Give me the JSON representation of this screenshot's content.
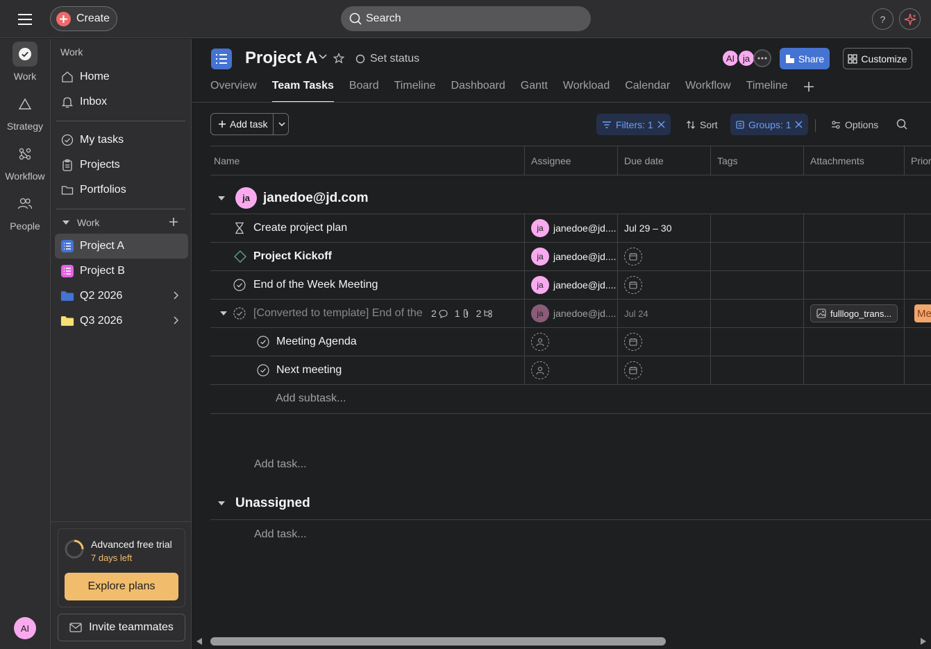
{
  "topbar": {
    "create_label": "Create",
    "search_placeholder": "Search",
    "help_label": "?"
  },
  "rail": {
    "items": [
      {
        "label": "Work",
        "icon": "check-circle-icon"
      },
      {
        "label": "Strategy",
        "icon": "triangle-icon"
      },
      {
        "label": "Workflow",
        "icon": "workflow-icon"
      },
      {
        "label": "People",
        "icon": "people-icon"
      }
    ],
    "avatar": "AI"
  },
  "sidebar": {
    "section_title": "Work",
    "nav": [
      {
        "label": "Home",
        "icon": "home-icon"
      },
      {
        "label": "Inbox",
        "icon": "bell-icon"
      }
    ],
    "nav2": [
      {
        "label": "My tasks",
        "icon": "check-circle-icon"
      },
      {
        "label": "Projects",
        "icon": "clipboard-icon"
      },
      {
        "label": "Portfolios",
        "icon": "folder-icon"
      }
    ],
    "work_group_title": "Work",
    "projects": [
      {
        "label": "Project A",
        "color": "#4573d2",
        "active": true
      },
      {
        "label": "Project B",
        "color": "#e362e3",
        "active": false
      },
      {
        "label": "Q2 2026",
        "color": "#4573d2",
        "type": "folder"
      },
      {
        "label": "Q3 2026",
        "color": "#f8df72",
        "type": "folder"
      }
    ],
    "trial": {
      "title": "Advanced free trial",
      "days_left": "7 days left",
      "explore": "Explore plans",
      "progress": 0.25
    },
    "invite": "Invite teammates"
  },
  "project": {
    "title": "Project A",
    "set_status": "Set status",
    "members": [
      "AI",
      "ja"
    ],
    "share": "Share",
    "customize": "Customize",
    "tabs": [
      "Overview",
      "Team Tasks",
      "Board",
      "Timeline",
      "Dashboard",
      "Gantt",
      "Workload",
      "Calendar",
      "Workflow",
      "Timeline"
    ],
    "active_tab": "Team Tasks"
  },
  "toolbar": {
    "add_task": "Add task",
    "filters": "Filters: 1",
    "sort": "Sort",
    "groups": "Groups: 1",
    "options": "Options"
  },
  "table": {
    "columns": [
      "Name",
      "Assignee",
      "Due date",
      "Tags",
      "Attachments",
      "Prior"
    ],
    "groups": [
      {
        "avatar": "ja",
        "title": "janedoe@jd.com",
        "tasks": [
          {
            "name": "Create project plan",
            "icon": "hourglass-icon",
            "assignee": "janedoe@jd....",
            "avatar": "ja",
            "due": "Jul 29 – 30"
          },
          {
            "name": "Project Kickoff",
            "icon": "milestone-icon",
            "assignee": "janedoe@jd....",
            "avatar": "ja",
            "due": ""
          },
          {
            "name": "End of the Week Meeting",
            "icon": "check-circle-icon",
            "assignee": "janedoe@jd....",
            "avatar": "ja",
            "due": ""
          },
          {
            "name": "[Converted to template] End of the",
            "icon": "check-circle-icon",
            "assignee": "janedoe@jd....",
            "avatar": "ja",
            "due": "Jul 24",
            "comments": "2",
            "attachments_count": "1",
            "subtasks": "2",
            "attachment": "fulllogo_trans...",
            "priority": "Me"
          }
        ],
        "subtasks": [
          {
            "name": "Meeting Agenda"
          },
          {
            "name": "Next meeting"
          }
        ],
        "add_subtask": "Add subtask...",
        "add_task": "Add task..."
      },
      {
        "title": "Unassigned",
        "add_task": "Add task..."
      }
    ]
  }
}
